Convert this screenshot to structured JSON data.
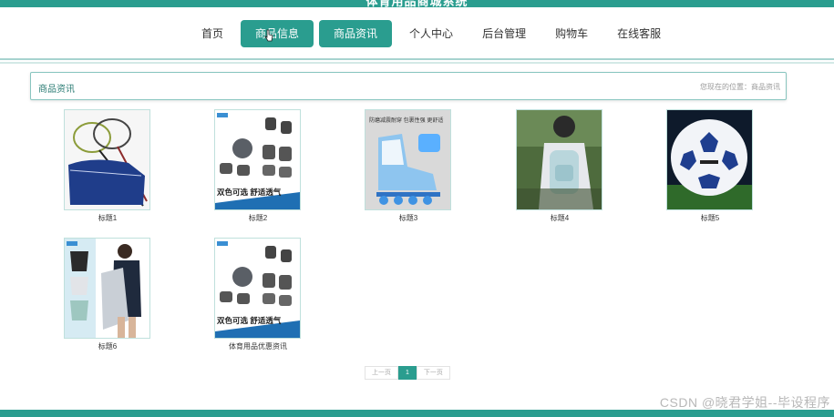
{
  "site": {
    "title": "体育用品商城系统"
  },
  "nav": {
    "items": [
      {
        "label": "首页",
        "active": false
      },
      {
        "label": "商品信息",
        "active": true
      },
      {
        "label": "商品资讯",
        "active": true
      },
      {
        "label": "个人中心",
        "active": false
      },
      {
        "label": "后台管理",
        "active": false
      },
      {
        "label": "购物车",
        "active": false
      },
      {
        "label": "在线客服",
        "active": false
      }
    ]
  },
  "breadcrumb": {
    "title": "商品资讯",
    "location": "您现在的位置：商品资讯"
  },
  "products": [
    {
      "label": "标题1",
      "image": "badminton-racket-bag"
    },
    {
      "label": "标题2",
      "image": "protective-pads",
      "caption": "双色可选 舒适透气"
    },
    {
      "label": "标题3",
      "image": "inline-skate",
      "caption": "防磨减震耐穿 包裹性强 更舒适"
    },
    {
      "label": "标题4",
      "image": "sports-backpack"
    },
    {
      "label": "标题5",
      "image": "soccer-ball"
    },
    {
      "label": "标题6",
      "image": "drawstring-bag"
    },
    {
      "label": "体育用品优惠资讯",
      "image": "protective-pads",
      "caption": "双色可选 舒适透气"
    }
  ],
  "pagination": {
    "prev": "上一页",
    "current": "1",
    "next": "下一页"
  },
  "watermark": "CSDN @晓君学姐--毕设程序",
  "colors": {
    "accent": "#2a9d8f",
    "border": "#88c5bf"
  }
}
